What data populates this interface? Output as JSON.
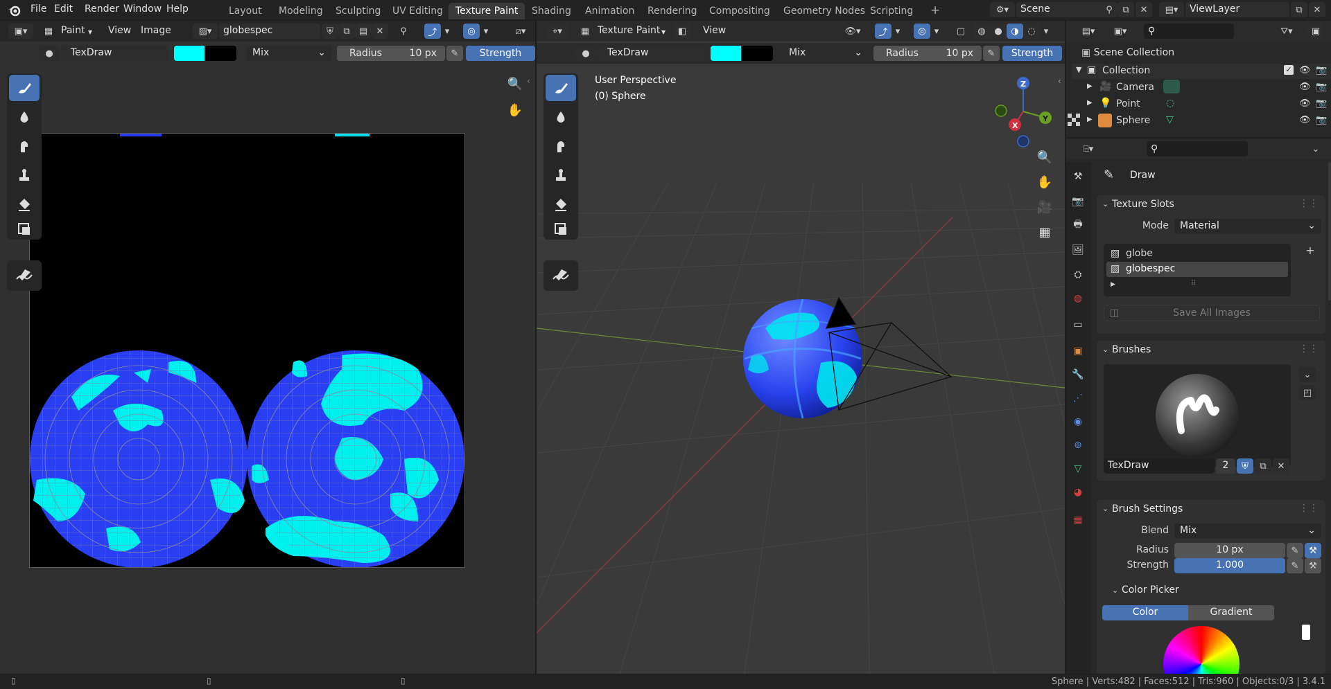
{
  "app": {
    "logo_icon": "blender-logo-icon"
  },
  "menubar": [
    "File",
    "Edit",
    "Render",
    "Window",
    "Help"
  ],
  "workspaces": [
    "Layout",
    "Modeling",
    "Sculpting",
    "UV Editing",
    "Texture Paint",
    "Shading",
    "Animation",
    "Rendering",
    "Compositing",
    "Geometry Nodes",
    "Scripting"
  ],
  "active_workspace": "Texture Paint",
  "add_workspace": "+",
  "scene": {
    "name": "Scene",
    "view_layer": "ViewLayer"
  },
  "image_editor": {
    "mode": "Paint",
    "menus": [
      "View",
      "Image"
    ],
    "image_name": "globespec",
    "tool_settings": {
      "brush": "TexDraw",
      "color": "#00ffff",
      "secondary_color": "#000000",
      "blend": "Mix",
      "radius_label": "Radius",
      "radius_value": "10 px",
      "strength_label": "Strength"
    }
  },
  "viewport": {
    "mode": "Texture Paint",
    "menus": [
      "View"
    ],
    "overlay_title": "User Perspective",
    "overlay_subtitle": "(0) Sphere",
    "tool_settings": {
      "brush": "TexDraw",
      "color": "#00ffff",
      "secondary_color": "#000000",
      "blend": "Mix",
      "radius_label": "Radius",
      "radius_value": "10 px",
      "strength_label": "Strength"
    },
    "gizmo": {
      "x": "X",
      "y": "Y",
      "z": "Z"
    }
  },
  "outliner": {
    "root": "Scene Collection",
    "collection": "Collection",
    "items": [
      {
        "name": "Camera",
        "icon": "camera-icon"
      },
      {
        "name": "Point",
        "icon": "light-icon"
      },
      {
        "name": "Sphere",
        "icon": "mesh-icon"
      }
    ]
  },
  "properties": {
    "tool_title": "Draw",
    "texture_slots": {
      "title": "Texture Slots",
      "mode_label": "Mode",
      "mode_value": "Material",
      "slots": [
        "globe",
        "globespec"
      ],
      "active_slot": "globespec",
      "save_all": "Save All Images"
    },
    "brushes": {
      "title": "Brushes",
      "brush_name": "TexDraw",
      "user_count": "2"
    },
    "brush_settings": {
      "title": "Brush Settings",
      "blend_label": "Blend",
      "blend_value": "Mix",
      "radius_label": "Radius",
      "radius_value": "10 px",
      "strength_label": "Strength",
      "strength_value": "1.000"
    },
    "color_picker": {
      "title": "Color Picker",
      "tabs": [
        "Color",
        "Gradient"
      ],
      "active_tab": "Color"
    }
  },
  "statusbar": {
    "text": "Sphere | Verts:482 | Faces:512 | Tris:960 | Objects:0/3 | 3.4.1"
  }
}
